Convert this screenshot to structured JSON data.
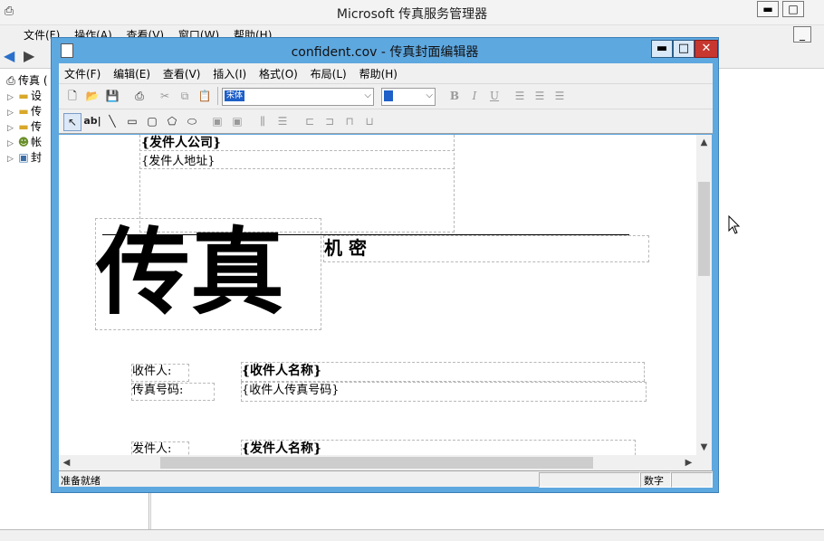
{
  "outer": {
    "title": "Microsoft 传真服务管理器",
    "menu": [
      "文件(F)",
      "操作(A)",
      "查看(V)",
      "窗口(W)",
      "帮助(H)"
    ],
    "tree": [
      {
        "label": "传真 (",
        "icon": "fax-icon"
      },
      {
        "label": "设",
        "icon": "folder-icon"
      },
      {
        "label": "传",
        "icon": "folder-icon"
      },
      {
        "label": "传",
        "icon": "folder-icon"
      },
      {
        "label": "帐",
        "icon": "users-icon"
      },
      {
        "label": "封",
        "icon": "cover-page-icon"
      }
    ]
  },
  "editor": {
    "title": "confident.cov - 传真封面编辑器",
    "menu": [
      "文件(F)",
      "编辑(E)",
      "查看(V)",
      "插入(I)",
      "格式(O)",
      "布局(L)",
      "帮助(H)"
    ],
    "font_name": "宋体",
    "status_left": "准备就绪",
    "status_mode": "数字",
    "cover": {
      "sender_company": "{发件人公司}",
      "sender_address": "{发件人地址}",
      "big_title": "传真",
      "confidential": "机   密",
      "recipient_label": "收件人:",
      "recipient_name": "{收件人名称}",
      "fax_number_label": "传真号码:",
      "recipient_fax": "{收件人传真号码}",
      "sender_label": "发件人:",
      "sender_name": "{发件人名称}"
    }
  },
  "colors": {
    "editor_frame": "#5ea8e0",
    "close_button": "#c7372f",
    "selection": "#1e5fc8"
  }
}
